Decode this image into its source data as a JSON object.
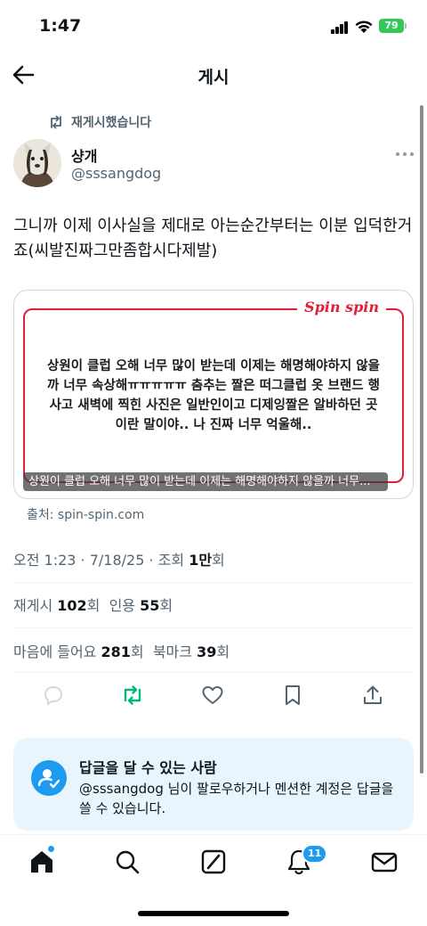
{
  "status_bar": {
    "time": "1:47",
    "battery": "79"
  },
  "nav": {
    "title": "게시"
  },
  "post": {
    "repost_label": "재게시했습니다",
    "author_name": "샹개",
    "author_handle": "@sssangdog",
    "text": "그니까 이제 이사실을 제대로 아는순간부터는 이분 입덕한거죠(씨발진짜그만좀합시다제발)",
    "card": {
      "brand": "Spin spin",
      "quote": "상원이 클럽 오해 너무 많이 받는데 이제는 해명해야하지 않을까 너무 속상해ㅠㅠㅠㅠㅠ 춤추는 짤은 떠그클럽 옷 브랜드 행사고 새벽에 찍힌 사진은 일반인이고 디제잉짤은 알바하던 곳이란 말이야.. 나 진짜 너무 억울해..",
      "caption": "상원이 클럽 오해 너무 많이 받는데 이제는 해명해야하지 않을까 너무...",
      "source": "출처: spin-spin.com"
    },
    "meta": {
      "time_date": "오전 1:23 · 7/18/25 · 조회 ",
      "views": "1만",
      "views_unit": "회"
    },
    "stats": {
      "reposts_label": "재게시 ",
      "reposts": "102",
      "reposts_unit": "회",
      "quotes_label": "인용 ",
      "quotes": "55",
      "quotes_unit": "회",
      "likes_label": "마음에 들어요 ",
      "likes": "281",
      "likes_unit": "회",
      "bookmarks_label": "북마크 ",
      "bookmarks": "39",
      "bookmarks_unit": "회"
    }
  },
  "reply_restriction": {
    "title": "답글을 달 수 있는 사람",
    "description": "@sssangdog 님이 팔로우하거나 멘션한 계정은 답글을 쓸 수 있습니다."
  },
  "tabbar": {
    "items": [
      "home-icon",
      "search-icon",
      "grok-icon",
      "notifications-icon",
      "messages-icon"
    ],
    "notification_count": "11"
  },
  "colors": {
    "accent": "#1d9bf0",
    "repost_green": "#00ba7c",
    "brand_red": "#e0203b"
  }
}
